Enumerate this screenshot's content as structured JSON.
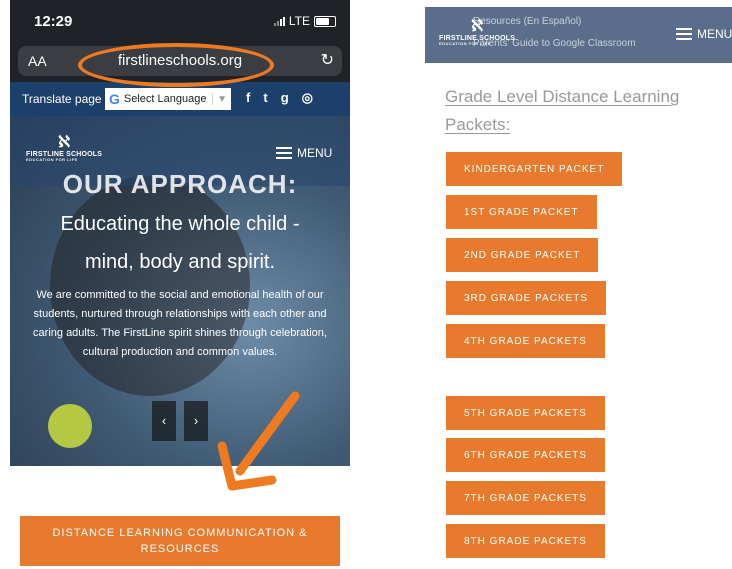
{
  "left": {
    "status": {
      "time": "12:29",
      "network": "LTE"
    },
    "url_bar": {
      "aa": "AA",
      "url": "firstlineschools.org"
    },
    "translate": {
      "label": "Translate page",
      "select": "Select Language",
      "google": "G"
    },
    "socials": {
      "facebook": "f",
      "twitter": "t",
      "google": "g",
      "instagram": "◎"
    },
    "logo": {
      "name": "FIRSTLINE SCHOOLS",
      "tagline": "EDUCATION FOR LIFE"
    },
    "menu_label": "MENU",
    "hero": {
      "title": "OUR APPROACH:",
      "subtitle1": "Educating the whole child -",
      "subtitle2": "mind, body and spirit.",
      "body": "We are committed to the social and emotional health of our students, nurtured through relationships with each other and caring adults. The FirstLine spirit shines through celebration, cultural production and common values.",
      "prev": "‹",
      "next": "›"
    },
    "cta": "DISTANCE LEARNING COMMUNICATION & RESOURCES"
  },
  "right": {
    "logo": {
      "name": "FIRSTLINE SCHOOLS",
      "tagline": "EDUCATION FOR LIFE"
    },
    "menu_label": "MENU",
    "links": [
      "Resources (En Español)",
      "Parents' Guide to Google Classroom"
    ],
    "section_title": "Grade Level Distance Learning Packets:",
    "packets": [
      "KINDERGARTEN PACKET",
      "1ST GRADE PACKET",
      "2ND GRADE PACKET",
      "3RD GRADE PACKETS",
      "4TH GRADE PACKETS",
      "5TH GRADE PACKETS",
      "6TH GRADE PACKETS",
      "7TH GRADE PACKETS",
      "8TH GRADE PACKETS"
    ]
  },
  "colors": {
    "accent": "#e87a2d",
    "nav": "#1d3f6b",
    "annotation": "#f07a20"
  }
}
